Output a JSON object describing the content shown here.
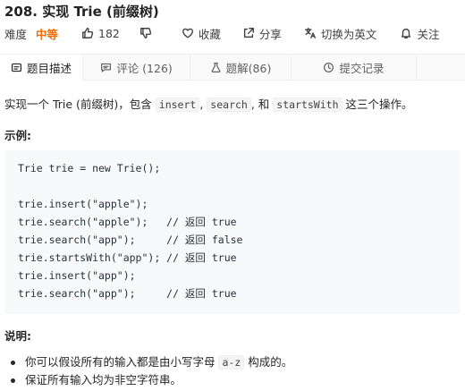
{
  "problem": {
    "title": "208. 实现 Trie (前缀树)",
    "difficulty_label": "难度",
    "difficulty": "中等",
    "likes": "182",
    "favorite_label": "收藏",
    "share_label": "分享",
    "language_label": "切换为英文",
    "follow_label": "关注",
    "colors": {
      "difficulty": "#ef6c00"
    }
  },
  "tabs": [
    {
      "label": "题目描述",
      "icon": "document-icon"
    },
    {
      "label": "评论 (126)",
      "icon": "comment-icon"
    },
    {
      "label": "题解(86)",
      "icon": "flask-icon"
    },
    {
      "label": "提交记录",
      "icon": "clock-icon"
    }
  ],
  "description": {
    "prefix": "实现一个 Trie (前缀树)，包含 ",
    "code1": "insert",
    "sep1": ",",
    "code2": "search",
    "sep2": ", 和 ",
    "code3": "startsWith",
    "suffix": " 这三个操作。"
  },
  "example_heading": "示例:",
  "code_lines": [
    "Trie trie = new Trie();",
    "",
    "trie.insert(\"apple\");",
    "trie.search(\"apple\");   // 返回 true",
    "trie.search(\"app\");     // 返回 false",
    "trie.startsWith(\"app\"); // 返回 true",
    "trie.insert(\"app\");",
    "trie.search(\"app\");     // 返回 true"
  ],
  "notes_heading": "说明:",
  "notes": {
    "item1_prefix": "你可以假设所有的输入都是由小写字母 ",
    "item1_code": "a-z",
    "item1_suffix": " 构成的。",
    "item2": "保证所有输入均为非空字符串。"
  }
}
